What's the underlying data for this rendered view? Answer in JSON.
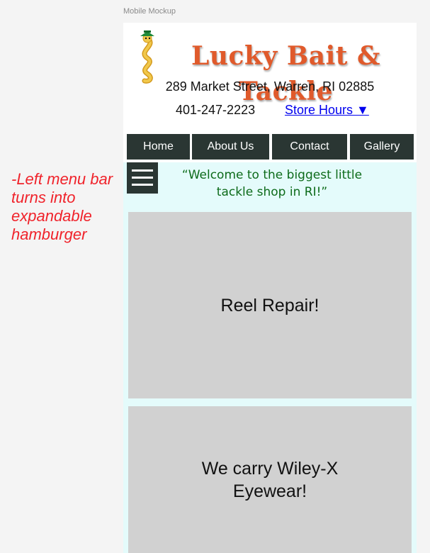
{
  "frame_label": "Mobile Mockup",
  "annotation": "-Left menu bar turns into expandable hamburger",
  "header": {
    "brand": "Lucky Bait & Tackle",
    "address": "289 Market Street, Warren, RI 02885",
    "phone": "401-247-2223",
    "store_hours": "Store Hours ▼",
    "logo_icon": "worm-mascot-icon"
  },
  "nav": {
    "items": [
      {
        "label": "Home"
      },
      {
        "label": "About Us"
      },
      {
        "label": "Contact"
      },
      {
        "label": "Gallery"
      }
    ]
  },
  "content": {
    "menu_icon": "hamburger-icon",
    "welcome": "“Welcome to the biggest little tackle shop in RI!”",
    "cards": [
      {
        "text": "Reel Repair!"
      },
      {
        "text": "We carry Wiley-X Eyewear!"
      }
    ]
  },
  "colors": {
    "page_bg": "#f4f4f4",
    "annotation": "#f0232b",
    "brand": "#e05a2b",
    "nav_bg": "#2a3633",
    "content_bg": "#e4fbfb",
    "card_bg": "#d1d1d1",
    "welcome_text": "#0d6b1a",
    "link": "#0000ee"
  }
}
